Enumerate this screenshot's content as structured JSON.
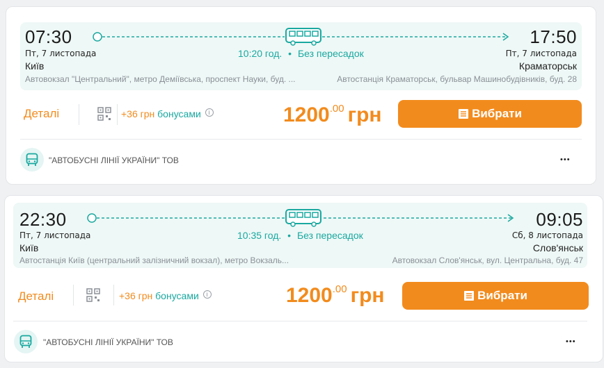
{
  "trips": [
    {
      "depart_time": "07:30",
      "depart_date": "Пт, 7 листопада",
      "depart_city": "Київ",
      "depart_station": "Автовокзал \"Центральний\", метро Деміївська, проспект Науки, буд. ...",
      "arrive_time": "17:50",
      "arrive_date": "Пт, 7 листопада",
      "arrive_city": "Краматорськ",
      "arrive_station": "Автостанція Краматорськ, бульвар Машинобудівників, буд. 28",
      "duration": "10:20 год.",
      "dot": "•",
      "transfers": "Без пересадок",
      "details_label": "Деталі",
      "bonus_amount": "+36 грн",
      "bonus_word": "бонусами",
      "info_mark": "i",
      "price_main": "1200",
      "price_cents": ".00",
      "currency": "грн",
      "select_label": "Вибрати",
      "carrier": "\"АВТОБУСНІ ЛІНІЇ УКРАЇНИ\" ТОВ",
      "more": "•••"
    },
    {
      "depart_time": "22:30",
      "depart_date": "Пт, 7 листопада",
      "depart_city": "Київ",
      "depart_station": "Автостанція Київ (центральний залізничний вокзал), метро Вокзаль...",
      "arrive_time": "09:05",
      "arrive_date": "Сб, 8 листопада",
      "arrive_city": "Слов'янськ",
      "arrive_station": "Автовокзал Слов'янськ, вул. Центральна, буд. 47",
      "duration": "10:35 год.",
      "dot": "•",
      "transfers": "Без пересадок",
      "details_label": "Деталі",
      "bonus_amount": "+36 грн",
      "bonus_word": "бонусами",
      "info_mark": "i",
      "price_main": "1200",
      "price_cents": ".00",
      "currency": "грн",
      "select_label": "Вибрати",
      "carrier": "\"АВТОБУСНІ ЛІНІЇ УКРАЇНИ\" ТОВ",
      "more": "•••"
    }
  ],
  "colors": {
    "accent_orange": "#f28b1d",
    "accent_teal": "#1aa8a0",
    "route_bg": "#eef8f6"
  },
  "icons": [
    "bus-icon",
    "arrow-right-icon",
    "qr-code-icon",
    "info-icon",
    "document-icon",
    "carrier-bus-icon",
    "more-icon"
  ]
}
